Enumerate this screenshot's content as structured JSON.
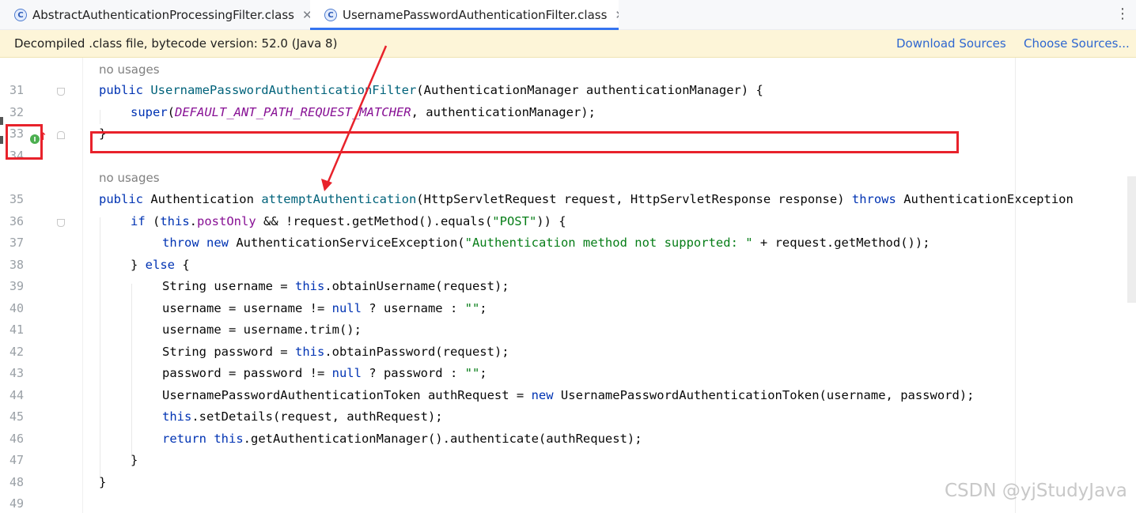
{
  "tabs": [
    {
      "label": "AbstractAuthenticationProcessingFilter.class",
      "active": false
    },
    {
      "label": "UsernamePasswordAuthenticationFilter.class",
      "active": true
    }
  ],
  "tab_icon_glyph": "C",
  "tab_close_glyph": "✕",
  "more_glyph": "⋮",
  "banner": {
    "text": "Decompiled .class file, bytecode version: 52.0 (Java 8)",
    "download_sources": "Download Sources",
    "choose_sources": "Choose Sources..."
  },
  "hints": {
    "h1": "no usages",
    "h2": "no usages"
  },
  "line_numbers": [
    "31",
    "32",
    "33",
    "34",
    "35",
    "36",
    "37",
    "38",
    "39",
    "40",
    "41",
    "42",
    "43",
    "44",
    "45",
    "46",
    "47",
    "48",
    "49"
  ],
  "code": {
    "l31": {
      "a": "public ",
      "b": "UsernamePasswordAuthenticationFilter",
      "c": "(AuthenticationManager authenticationManager) {"
    },
    "l32": {
      "a": "super",
      "b": "(",
      "c": "DEFAULT_ANT_PATH_REQUEST_MATCHER",
      "d": ", authenticationManager);"
    },
    "l33": {
      "a": "}"
    },
    "l35": {
      "a": "public ",
      "b": "Authentication ",
      "c": "attemptAuthentication",
      "d": "(HttpServletRequest request, HttpServletResponse response) ",
      "e": "throws",
      "f": " AuthenticationException"
    },
    "l36": {
      "a": "if ",
      "b": "(",
      "c": "this",
      "d": ".",
      "e": "postOnly",
      "f": " && !request.getMethod().equals(",
      "g": "\"POST\"",
      "h": ")) {"
    },
    "l37": {
      "a": "throw new ",
      "b": "AuthenticationServiceException(",
      "c": "\"Authentication method not supported: \"",
      "d": " + request.getMethod());"
    },
    "l38": {
      "a": "} ",
      "b": "else",
      "c": " {"
    },
    "l39": {
      "a": "String username = ",
      "b": "this",
      "c": ".obtainUsername(request);"
    },
    "l40": {
      "a": "username = username != ",
      "b": "null",
      "c": " ? username : ",
      "d": "\"\"",
      "e": ";"
    },
    "l41": {
      "a": "username = username.trim();"
    },
    "l42": {
      "a": "String password = ",
      "b": "this",
      "c": ".obtainPassword(request);"
    },
    "l43": {
      "a": "password = password != ",
      "b": "null",
      "c": " ? password : ",
      "d": "\"\"",
      "e": ";"
    },
    "l44": {
      "a": "UsernamePasswordAuthenticationToken authRequest = ",
      "b": "new",
      "c": " UsernamePasswordAuthenticationToken(username, password);"
    },
    "l45": {
      "a": "this",
      "b": ".setDetails(request, authRequest);"
    },
    "l46": {
      "a": "return ",
      "b": "this",
      "c": ".getAuthenticationManager().authenticate(authRequest);"
    },
    "l47": {
      "a": "}"
    },
    "l48": {
      "a": "}"
    }
  },
  "gutter_icons": {
    "override": "I",
    "arrow": "↑"
  },
  "watermark": "CSDN @yjStudyJava",
  "colors": {
    "keyword": "#0033b3",
    "method_decl": "#00627a",
    "field": "#871094",
    "string": "#067d17",
    "annotation_red": "#e8222b",
    "link": "#2f67d0"
  }
}
